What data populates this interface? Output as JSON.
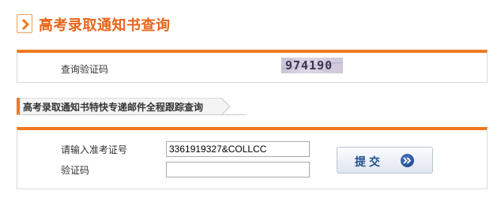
{
  "page": {
    "title": "高考录取通知书查询"
  },
  "captcha_section": {
    "label": "查询验证码",
    "code": "974190"
  },
  "tracking_section": {
    "title": "高考录取通知书特快专递邮件全程跟踪查询",
    "ticket_label": "请输入准考证号",
    "ticket_value": "3361919327&COLLCC",
    "verify_label": "验证码",
    "verify_value": "",
    "submit_label": "提交"
  },
  "colors": {
    "accent": "#ef7a22",
    "title": "#e8651a",
    "button_text": "#1f4e8c"
  },
  "icons": {
    "title_arrow": "chevron-right-icon",
    "submit_arrow": "double-chevron-right-icon"
  }
}
